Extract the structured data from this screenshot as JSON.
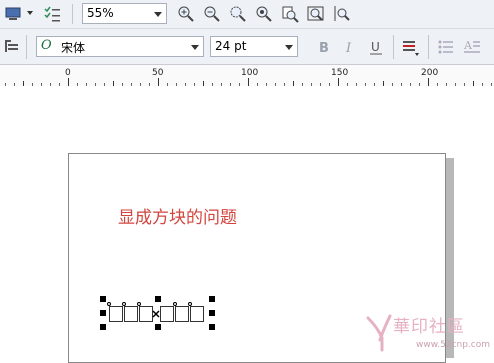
{
  "toolbar": {
    "zoom": {
      "value": "55%"
    },
    "font": {
      "name": "宋体",
      "type_glyph": "O"
    },
    "font_size": {
      "value": "24 pt"
    }
  },
  "ruler": {
    "labels": [
      "0",
      "50",
      "100",
      "150",
      "200"
    ]
  },
  "document": {
    "text": "显成方块的问题"
  },
  "watermark": {
    "text": "華印社區",
    "url": "www.52cnp.com"
  },
  "colors": {
    "toolbar_bg": "#eef1f5",
    "doc_text": "#d2463f",
    "watermark": "#e6b1c2"
  }
}
